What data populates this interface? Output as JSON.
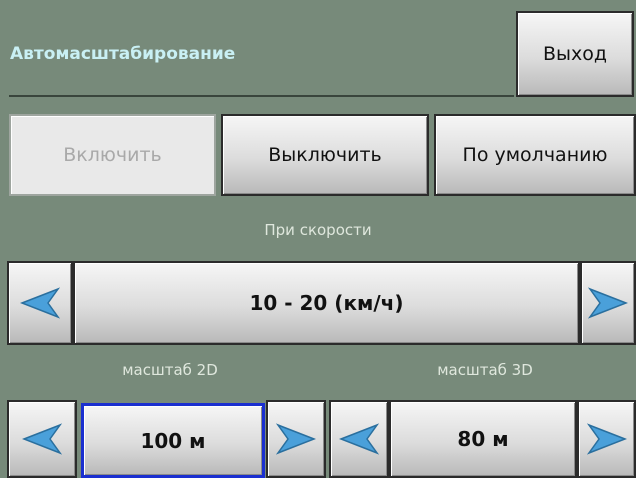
{
  "title": "Автомасштабирование",
  "exit_label": "Выход",
  "mode_buttons": {
    "enable": "Включить",
    "disable": "Выключить",
    "default": "По умолчанию"
  },
  "speed": {
    "label": "При скорости",
    "value": "10 - 20 (км/ч)"
  },
  "scale_2d": {
    "label": "масштаб 2D",
    "value": "100 м"
  },
  "scale_3d": {
    "label": "масштаб 3D",
    "value": "80 м"
  },
  "icons": {
    "left": "arrow-left-icon",
    "right": "arrow-right-icon"
  },
  "colors": {
    "background": "#778a7a",
    "title": "#c9f0f4",
    "selection": "#1a2fd0",
    "arrow": "#4aa0da"
  }
}
